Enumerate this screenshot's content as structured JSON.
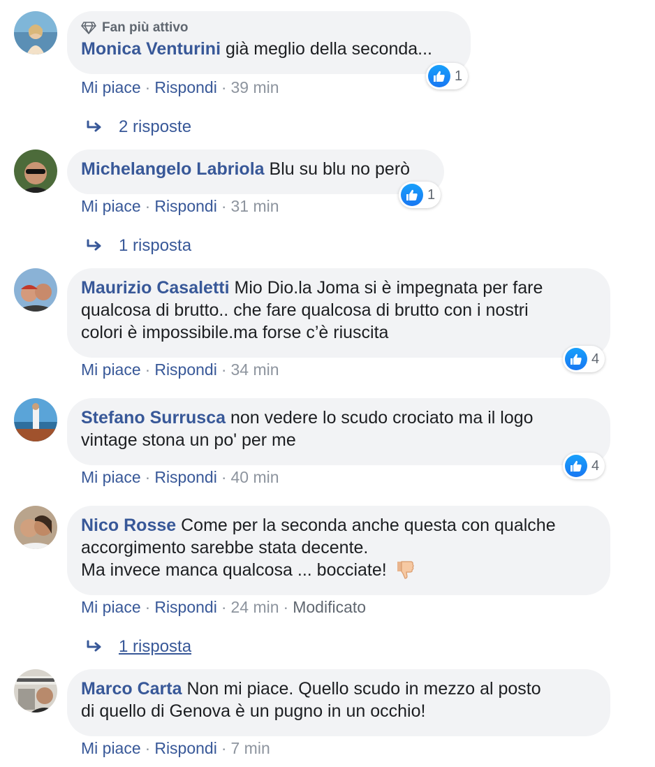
{
  "actions": {
    "like": "Mi piace",
    "reply": "Rispondi",
    "edited": "Modificato"
  },
  "comments": [
    {
      "badge": "Fan più attivo",
      "author": "Monica Venturini",
      "text": "già meglio della seconda...",
      "reactions": "1",
      "time": "39 min",
      "replies": "2 risposte"
    },
    {
      "author": "Michelangelo Labriola",
      "text": "Blu su blu no però",
      "reactions": "1",
      "time": "31 min",
      "replies": "1 risposta"
    },
    {
      "author": "Maurizio Casaletti",
      "text": "Mio Dio.la Joma si è impegnata per fare",
      "text2": "qualcosa di brutto.. che fare qualcosa di brutto con i nostri",
      "text3": "colori è impossibile.ma forse c’è riuscita",
      "reactions": "4",
      "time": "34 min"
    },
    {
      "author": "Stefano Surrusca",
      "text": "non vedere lo scudo crociato ma il logo",
      "text2": "vintage stona un po' per me",
      "reactions": "4",
      "time": "40 min"
    },
    {
      "author": "Nico Rosse",
      "text": "Come per la seconda anche questa con qualche",
      "text2": "accorgimento sarebbe stata decente.",
      "text3": "Ma invece manca qualcosa ... bocciate!",
      "time": "24 min",
      "replies": "1 risposta"
    },
    {
      "author": "Marco Carta",
      "text": "Non mi piace. Quello scudo in mezzo al posto",
      "text2": "di quello di Genova è un pugno in un occhio!",
      "time": "7 min"
    }
  ]
}
